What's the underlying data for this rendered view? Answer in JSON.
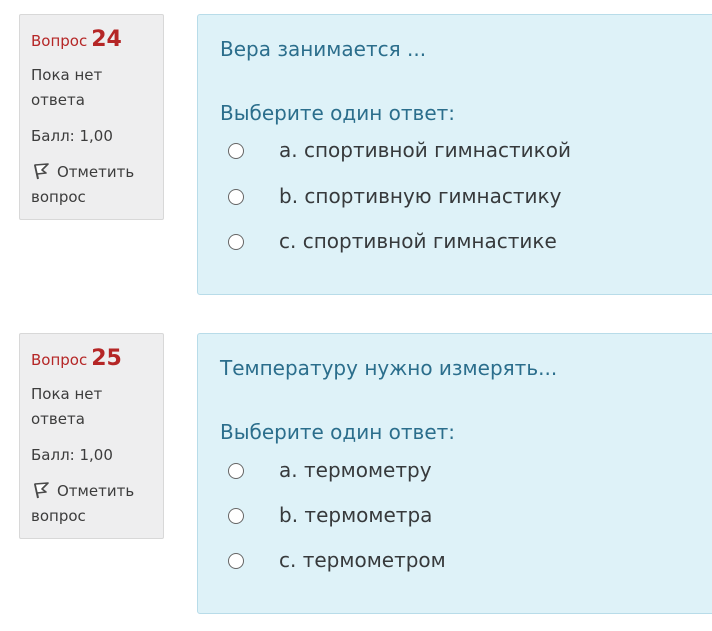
{
  "questions": [
    {
      "label_word": "Вопрос",
      "number": "24",
      "state": "Пока нет ответа",
      "grade": "Балл: 1,00",
      "flag_label": "Отметить вопрос",
      "flag_icon": "flag-icon",
      "text": "Вера занимается ...",
      "prompt": "Выберите один ответ:",
      "answers": [
        {
          "letter": "a.",
          "text": "спортивной гимнастикой"
        },
        {
          "letter": "b.",
          "text": "спортивную гимнастику"
        },
        {
          "letter": "c.",
          "text": "спортивной гимнастике"
        }
      ]
    },
    {
      "label_word": "Вопрос",
      "number": "25",
      "state": "Пока нет ответа",
      "grade": "Балл: 1,00",
      "flag_label": "Отметить вопрос",
      "flag_icon": "flag-icon",
      "text": "Температуру нужно измерять...",
      "prompt": "Выберите один ответ:",
      "answers": [
        {
          "letter": "a.",
          "text": "термометру"
        },
        {
          "letter": "b.",
          "text": "термометра"
        },
        {
          "letter": "c.",
          "text": "термометром"
        }
      ]
    }
  ],
  "colors": {
    "question_number": "#b52626",
    "info_background": "#eeeeef",
    "content_background": "#def2f8",
    "question_text": "#2b6e8c",
    "answer_text": "#373a3c"
  }
}
